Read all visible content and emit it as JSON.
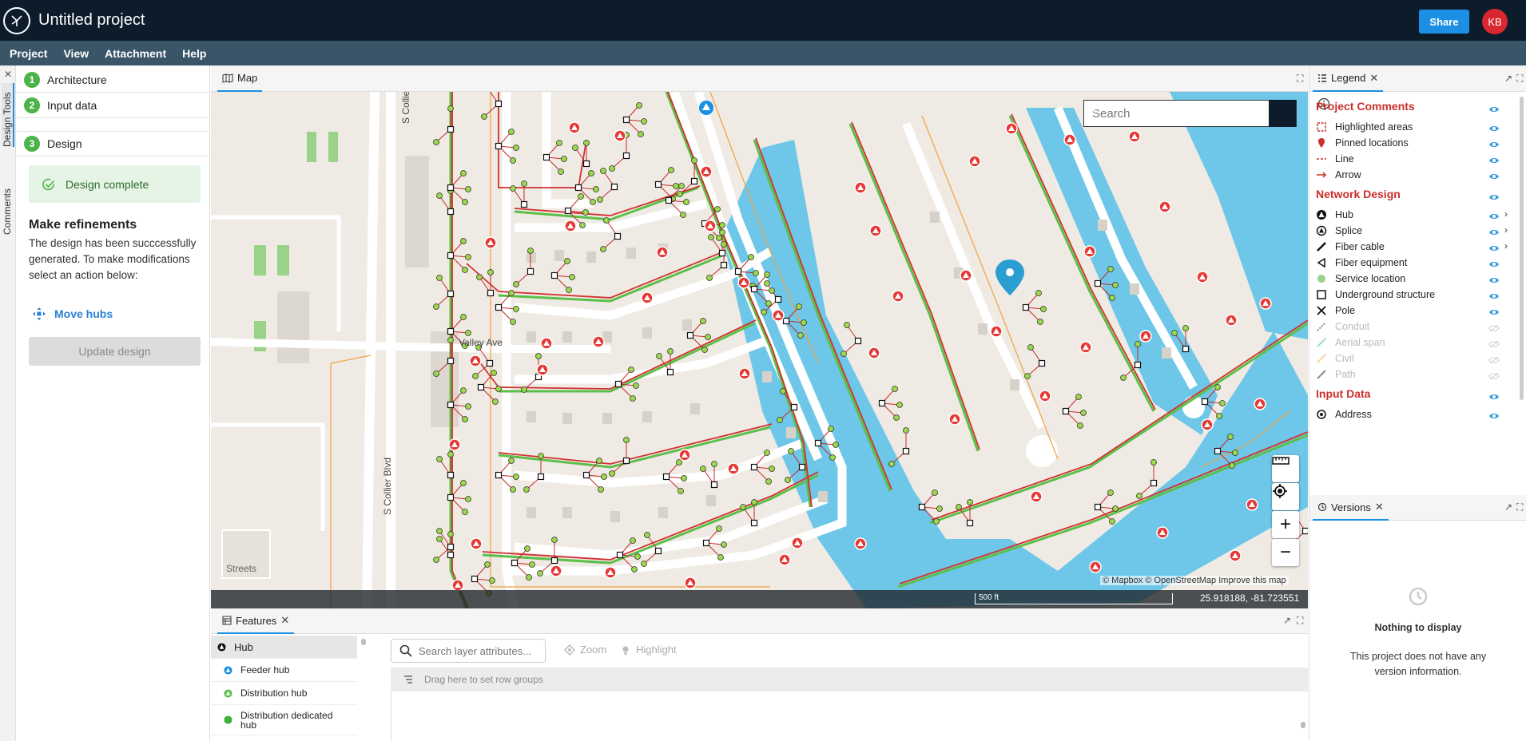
{
  "app": {
    "title": "Untitled project",
    "share_label": "Share",
    "avatar_initials": "KB"
  },
  "menu": [
    "Project",
    "View",
    "Attachment",
    "Help"
  ],
  "side_tabs": [
    "Design Tools",
    "Comments"
  ],
  "left_panel": {
    "steps": [
      {
        "num": "1",
        "label": "Architecture"
      },
      {
        "num": "2",
        "label": "Input data"
      },
      {
        "num": "3",
        "label": "Design"
      }
    ],
    "status": "Design complete",
    "refine_title": "Make refinements",
    "refine_text": "The design has been succcessfully generated. To make modifications select an action below:",
    "move_hubs": "Move hubs",
    "update_button": "Update design"
  },
  "map": {
    "tab_label": "Map",
    "search_placeholder": "Search",
    "street_labels": [
      "S Collier",
      "Valley Ave",
      "S Collier Blvd"
    ],
    "basemap_label": "Streets",
    "attribution": "© Mapbox © OpenStreetMap Improve this map",
    "scale_label": "500 ft",
    "coordinates": "25.918188, -81.723551",
    "controls": [
      "ruler-icon",
      "locate-icon",
      "zoom-in-icon",
      "zoom-out-icon"
    ]
  },
  "features": {
    "tab_label": "Features",
    "items": [
      {
        "label": "Hub",
        "icon": "hub-icon"
      },
      {
        "label": "Feeder hub",
        "icon": "feeder-hub-icon"
      },
      {
        "label": "Distribution hub",
        "icon": "distribution-hub-icon"
      },
      {
        "label": "Distribution dedicated hub",
        "icon": "dedicated-hub-icon"
      }
    ],
    "search_placeholder": "Search layer attributes...",
    "zoom_label": "Zoom",
    "highlight_label": "Highlight",
    "group_hint": "Drag here to set row groups"
  },
  "legend": {
    "tab_label": "Legend",
    "sections": [
      {
        "title": "Project Comments",
        "items": [
          {
            "label": "Highlighted areas",
            "icon": "highlight-area-icon",
            "color": "#c9302c"
          },
          {
            "label": "Pinned locations",
            "icon": "pin-icon",
            "color": "#c9302c"
          },
          {
            "label": "Line",
            "icon": "line-icon",
            "color": "#c9302c"
          },
          {
            "label": "Arrow",
            "icon": "arrow-icon",
            "color": "#c9302c"
          }
        ]
      },
      {
        "title": "Network Design",
        "items": [
          {
            "label": "Hub",
            "icon": "hub-icon"
          },
          {
            "label": "Splice",
            "icon": "splice-icon"
          },
          {
            "label": "Fiber cable",
            "icon": "fiber-cable-icon"
          },
          {
            "label": "Fiber equipment",
            "icon": "fiber-equipment-icon"
          },
          {
            "label": "Service location",
            "icon": "service-location-icon"
          },
          {
            "label": "Underground structure",
            "icon": "underground-structure-icon"
          },
          {
            "label": "Pole",
            "icon": "pole-icon"
          },
          {
            "label": "Conduit",
            "icon": "conduit-icon"
          },
          {
            "label": "Aerial span",
            "icon": "aerial-span-icon"
          },
          {
            "label": "Civil",
            "icon": "civil-icon"
          },
          {
            "label": "Path",
            "icon": "path-icon"
          }
        ]
      },
      {
        "title": "Input Data",
        "items": [
          {
            "label": "Address",
            "icon": "address-icon"
          }
        ]
      }
    ]
  },
  "versions": {
    "tab_label": "Versions",
    "empty_title": "Nothing to display",
    "empty_text": "This project does not have any version information."
  }
}
